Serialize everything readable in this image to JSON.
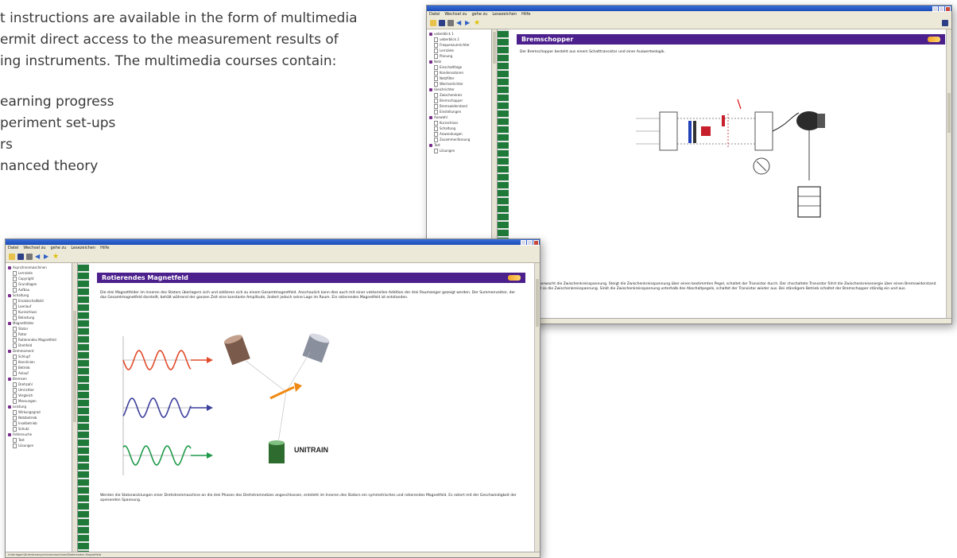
{
  "intro": {
    "lines": [
      "t instructions are available in the form of multimedia",
      "ermit direct access to the measurement results of",
      "ing instruments. The multimedia courses contain:"
    ],
    "bullets": [
      "earning progress",
      "periment set-ups",
      "rs",
      "nanced theory"
    ]
  },
  "window_back": {
    "menu": [
      "Datei",
      "Wechsel zu",
      "gehe zu",
      "Lesezeichen",
      "Hilfe"
    ],
    "heading": "Bremschopper",
    "text_top": "Der Bremschopper besteht aus einem Schalttransistor und einer Auswerteelogik.",
    "text_bottom": "ermschopper überwacht die Zwischenkreisspannung. Steigt die Zwischenkreisspannung über einen bestimmten Pegel, schaltet der Transistor durch. Der chschaltete Transistor führt die Zwischenkreisenergie über einen Bremswiderstand ab und reduziert so die Zwischenkreisspannung. Sinkt die Zwischenkreisspannung unterhalb des Abschaltpegels, schaltet der Transistor wieder aus. Bei ständigem Betrieb schaltet der Bremschopper ständig ein und aus.",
    "tree_items": [
      "ueberblick 1",
      "ueberblick 2",
      "Frequenzumrichter",
      "Lernziele",
      "Planung",
      "Netz",
      "Einschaltfolge",
      "Kondensatoren",
      "Netzfilter",
      "Wechselrichter",
      "Gleichrichter",
      "Zwischenkreis",
      "Bremschopper",
      "Bremswiderstand",
      "Einstellungen",
      "Auswahl",
      "Kurzschluss",
      "Schaltung",
      "Anwendungen",
      "Zusammenfassung",
      "Test",
      "Lösungen"
    ]
  },
  "window_front": {
    "menu": [
      "Datei",
      "Wechsel zu",
      "gehe zu",
      "Lesezeichen",
      "Hilfe"
    ],
    "heading": "Rotierendes Magnetfeld",
    "text_top": "Die drei Magnetfelder im Inneren des Stators überlagern sich und addieren sich zu einem Gesamtmagnetfeld. Anschaulich kann dies auch mit einer vektoriellen Addition der drei Raumzeiger gezeigt werden. Der Summenvektor, der das Gesamtmagnetfeld darstellt, behält während der ganzen Zeit eine konstante Amplitude, ändert jedoch seine Lage im Raum. Ein rotierendes Magnetfeld ist entstanden.",
    "text_bottom": "Werden die Statorwicklungen einer Drehstrommaschine an die drei Phasen des Drehstromnetzes angeschlossen, entsteht im Inneren des Stators ein symmetrisches und rotierendes Magnetfeld. Es rotiert mit der Geschwindigkeit der speisenden Spannung.",
    "status": "Unterlagen\\Drehstromsynchronmaschinen\\Rotierendes Magnetfeld",
    "logo_text": "UNITRAIN",
    "tree_items": [
      "Asynchronmaschinen",
      "Lernziele",
      "Copyright",
      "Grundlagen",
      "Aufbau",
      "Schaltung",
      "Ersatzschaltbild",
      "Leerlauf",
      "Kurzschluss",
      "Belastung",
      "Magnetfelder",
      "Stator",
      "Rotor",
      "Rotierendes Magnetfeld",
      "Drehfeld",
      "Drehmoment",
      "Schlupf",
      "Kennlinien",
      "Betrieb",
      "Anlauf",
      "Bremsen",
      "Drehzahl",
      "Umrichter",
      "Vergleich",
      "Messungen",
      "Leistung",
      "Wirkungsgrad",
      "Netzbetrieb",
      "Inselbetrieb",
      "Schutz",
      "Fehlersuche",
      "Test",
      "Lösungen"
    ]
  },
  "colors": {
    "heading_bg": "#4b1f8c",
    "spiral": "#1f7a3a",
    "sine_red": "#e14b2a",
    "sine_blue": "#3c3f9c",
    "sine_green": "#1f9a4a"
  }
}
